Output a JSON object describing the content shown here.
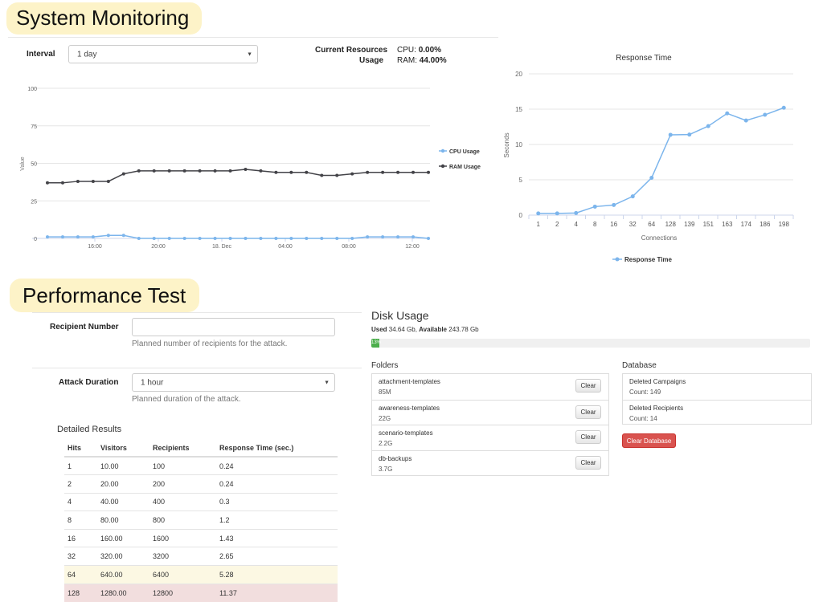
{
  "system": {
    "title": "System Monitoring",
    "interval_label": "Interval",
    "interval_value": "1 day",
    "resources_label_1": "Current Resources",
    "resources_label_2": "Usage",
    "cpu_label": "CPU:",
    "cpu_value": "0.00%",
    "ram_label": "RAM:",
    "ram_value": "44.00%"
  },
  "usage_chart": {
    "type": "line",
    "ylabel": "Value",
    "ylim": [
      0,
      100
    ],
    "y_ticks": [
      "0",
      "25",
      "50",
      "75",
      "100"
    ],
    "x_ticks": [
      "16:00",
      "20:00",
      "18. Dec",
      "04:00",
      "08:00",
      "12:00"
    ],
    "series": [
      {
        "name": "CPU Usage",
        "color": "#7cb5ec",
        "values": [
          1,
          1,
          1,
          1,
          2,
          2,
          0,
          0,
          0,
          0,
          0,
          0,
          0,
          0,
          0,
          0,
          0,
          0,
          0,
          0,
          0,
          1,
          1,
          1,
          1,
          0
        ]
      },
      {
        "name": "RAM Usage",
        "color": "#434348",
        "values": [
          37,
          37,
          38,
          38,
          38,
          43,
          45,
          45,
          45,
          45,
          45,
          45,
          45,
          46,
          45,
          44,
          44,
          44,
          42,
          42,
          43,
          44,
          44,
          44,
          44,
          44
        ]
      }
    ]
  },
  "response_chart": {
    "type": "line",
    "title": "Response Time",
    "ylabel": "Seconds",
    "xlabel": "Connections",
    "ylim": [
      0,
      20
    ],
    "y_ticks": [
      "0",
      "5",
      "10",
      "15",
      "20"
    ],
    "categories": [
      "1",
      "2",
      "4",
      "8",
      "16",
      "32",
      "64",
      "128",
      "139",
      "151",
      "163",
      "174",
      "186",
      "198"
    ],
    "series": [
      {
        "name": "Response Time",
        "color": "#7cb5ec",
        "values": [
          0.24,
          0.24,
          0.3,
          1.2,
          1.43,
          2.65,
          5.28,
          11.37,
          11.4,
          12.6,
          14.4,
          13.4,
          14.2,
          15.2
        ]
      }
    ]
  },
  "performance": {
    "title": "Performance Test",
    "recipient_label": "Recipient Number",
    "recipient_value": "",
    "recipient_help": "Planned number of recipients for the attack.",
    "duration_label": "Attack Duration",
    "duration_value": "1 hour",
    "duration_help": "Planned duration of the attack."
  },
  "results": {
    "title": "Detailed Results",
    "headers": [
      "Hits",
      "Visitors",
      "Recipients",
      "Response Time (sec.)"
    ],
    "rows": [
      [
        "1",
        "10.00",
        "100",
        "0.24"
      ],
      [
        "2",
        "20.00",
        "200",
        "0.24"
      ],
      [
        "4",
        "40.00",
        "400",
        "0.3"
      ],
      [
        "8",
        "80.00",
        "800",
        "1.2"
      ],
      [
        "16",
        "160.00",
        "1600",
        "1.43"
      ],
      [
        "32",
        "320.00",
        "3200",
        "2.65"
      ],
      [
        "64",
        "640.00",
        "6400",
        "5.28"
      ],
      [
        "128",
        "1280.00",
        "12800",
        "11.37"
      ]
    ],
    "row_status": [
      "",
      "",
      "",
      "",
      "",
      "",
      "warn",
      "danger"
    ]
  },
  "disk": {
    "title": "Disk Usage",
    "used_label": "Used",
    "used_value": "34.64 Gb,",
    "available_label": "Available",
    "available_value": "243.78 Gb",
    "percent": 13,
    "percent_label": "13%",
    "folders_title": "Folders",
    "folders": [
      {
        "name": "attachment-templates",
        "size": "85M",
        "button": "Clear"
      },
      {
        "name": "awareness-templates",
        "size": "22G",
        "button": "Clear"
      },
      {
        "name": "scenario-templates",
        "size": "2.2G",
        "button": "Clear"
      },
      {
        "name": "db-backups",
        "size": "3.7G",
        "button": "Clear"
      }
    ],
    "database_title": "Database",
    "database": [
      {
        "name": "Deleted Campaigns",
        "count": "Count: 149"
      },
      {
        "name": "Deleted Recipients",
        "count": "Count: 14"
      }
    ],
    "clear_db_label": "Clear Database"
  }
}
